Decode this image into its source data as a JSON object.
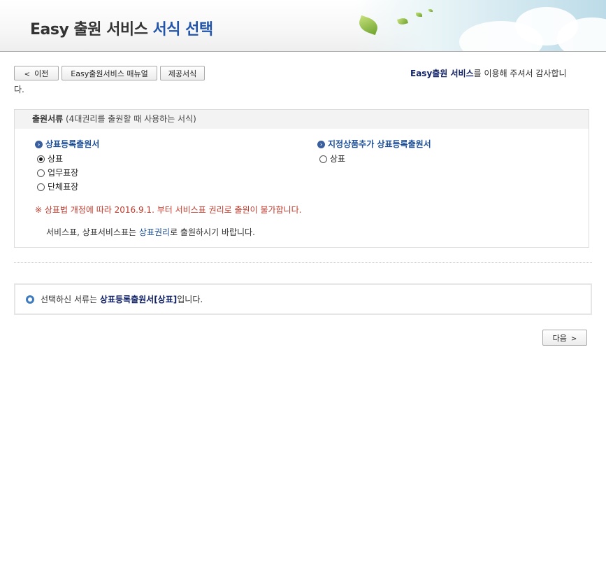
{
  "header": {
    "title_prefix": "Easy 출원 서비스",
    "title_highlight": "서식 선택"
  },
  "toolbar": {
    "prev_label": "이전",
    "manual_label": "Easy출원서비스 매뉴얼",
    "forms_label": "제공서식"
  },
  "thanks": {
    "service_name": "Easy출원 서비스",
    "message": "를 이용해 주셔서 감사합니",
    "wrap": "다."
  },
  "panel": {
    "heading": "출원서류",
    "heading_note": "(4대권리를 출원할 때 사용하는 서식)",
    "groups": [
      {
        "title": "상표등록출원서",
        "options": [
          {
            "label": "상표",
            "checked": true
          },
          {
            "label": "업무표장",
            "checked": false
          },
          {
            "label": "단체표장",
            "checked": false
          }
        ]
      },
      {
        "title": "지정상품추가 상표등록출원서",
        "options": [
          {
            "label": "상표",
            "checked": false
          }
        ]
      }
    ],
    "notice": "※ 상표법 개정에 따라 2016.9.1. 부터 서비스표 권리로 출원이 불가합니다.",
    "note_before": "서비스표, 상표서비스표는 ",
    "note_link": "상표권리",
    "note_after": "로 출원하시기 바랍니다."
  },
  "selection": {
    "prefix": "선택하신 서류는 ",
    "selected": "상표등록출원서[상표]",
    "suffix": "입니다."
  },
  "next_label": "다음",
  "colors": {
    "accent_blue": "#2255aa",
    "notice_red": "#c0392b",
    "navy": "#112266"
  }
}
